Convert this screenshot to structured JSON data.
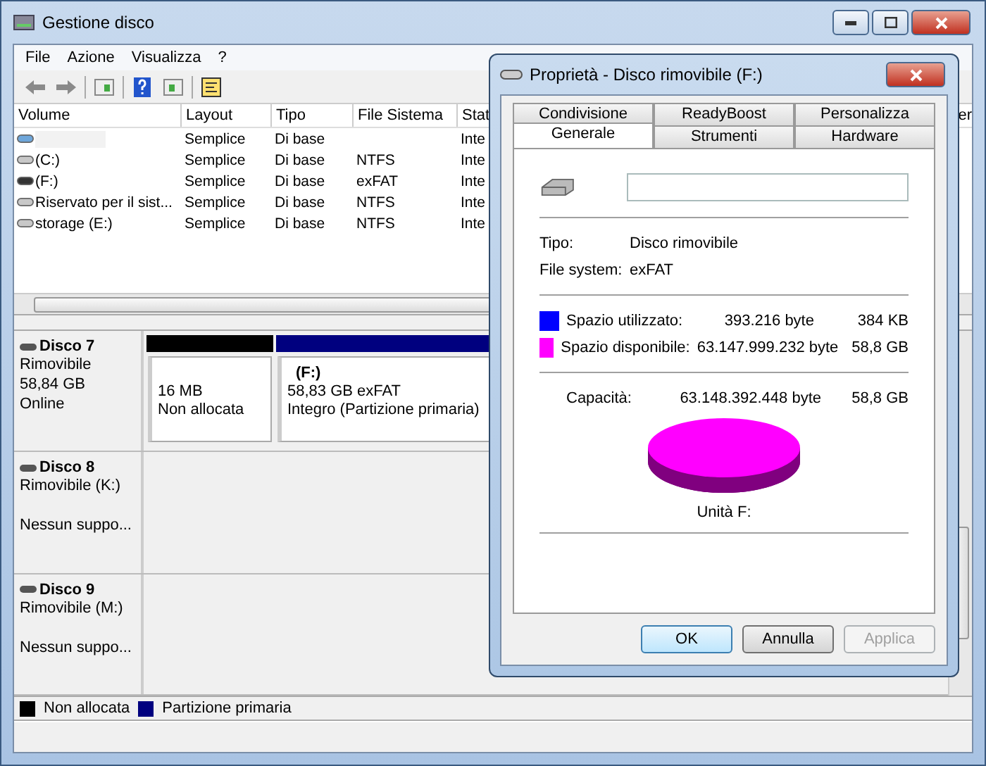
{
  "window": {
    "title": "Gestione disco"
  },
  "menu": [
    "File",
    "Azione",
    "Visualizza",
    "?"
  ],
  "volumes": {
    "columns": [
      "Volume",
      "Layout",
      "Tipo",
      "File Sistema",
      "Stat"
    ],
    "column_6": "er",
    "rows": [
      {
        "kind": "system",
        "layout": "Semplice",
        "type": "Di base",
        "status": "Inte"
      },
      {
        "kind": "disk",
        "volume": "(C:)",
        "layout": "Semplice",
        "type": "Di base",
        "fs": "NTFS",
        "status": "Inte"
      },
      {
        "kind": "removable",
        "volume": "(F:)",
        "layout": "Semplice",
        "type": "Di base",
        "fs": "exFAT",
        "status": "Inte"
      },
      {
        "kind": "disk",
        "volume": "Riservato per il sist...",
        "layout": "Semplice",
        "type": "Di base",
        "fs": "NTFS",
        "status": "Inte"
      },
      {
        "kind": "disk",
        "volume": "storage (E:)",
        "layout": "Semplice",
        "type": "Di base",
        "fs": "NTFS",
        "status": "Inte"
      }
    ]
  },
  "disks": [
    {
      "name": "Disco 7",
      "type": "Rimovibile",
      "size": "58,84 GB",
      "status": "Online",
      "partitions": [
        {
          "lines": [
            "16 MB",
            "Non allocata"
          ],
          "color": "#000000"
        },
        {
          "title": "(F:)",
          "lines": [
            "58,83 GB exFAT",
            "Integro (Partizione primaria)"
          ],
          "color": "#00007f"
        }
      ]
    },
    {
      "name": "Disco 8",
      "type": "Rimovibile (K:)",
      "status": "Nessun suppo..."
    },
    {
      "name": "Disco 9",
      "type": "Rimovibile (M:)",
      "status": "Nessun suppo..."
    }
  ],
  "legend": [
    {
      "label": "Non allocata",
      "color": "#000000"
    },
    {
      "label": "Partizione primaria",
      "color": "#00007f"
    }
  ],
  "dialog": {
    "title": "Proprietà - Disco rimovibile (F:)",
    "tabs_back": [
      {
        "label": "Condivisione",
        "selected": false
      },
      {
        "label": "ReadyBoost",
        "selected": false
      },
      {
        "label": "Personalizza",
        "selected": false
      }
    ],
    "tabs_front": [
      {
        "label": "Generale",
        "selected": true
      },
      {
        "label": "Strumenti",
        "selected": false
      },
      {
        "label": "Hardware",
        "selected": false
      }
    ],
    "info": [
      {
        "label": "Tipo:",
        "value": "Disco rimovibile"
      },
      {
        "label": "File system:",
        "value": "exFAT"
      }
    ],
    "usage": [
      {
        "label": "Spazio utilizzato:",
        "bytes": "393.216 byte",
        "size": "384 KB",
        "color": "#0000ff"
      },
      {
        "label": "Spazio disponibile:",
        "bytes": "63.147.999.232 byte",
        "size": "58,8 GB",
        "color": "#ff00ff"
      }
    ],
    "capacity": {
      "label": "Capacità:",
      "bytes": "63.148.392.448 byte",
      "size": "58,8 GB"
    },
    "drive_label": "Unità F:",
    "buttons": [
      {
        "label": "OK",
        "default": true,
        "disabled": false
      },
      {
        "label": "Annulla",
        "default": false,
        "disabled": false
      },
      {
        "label": "Applica",
        "default": false,
        "disabled": true
      }
    ]
  }
}
